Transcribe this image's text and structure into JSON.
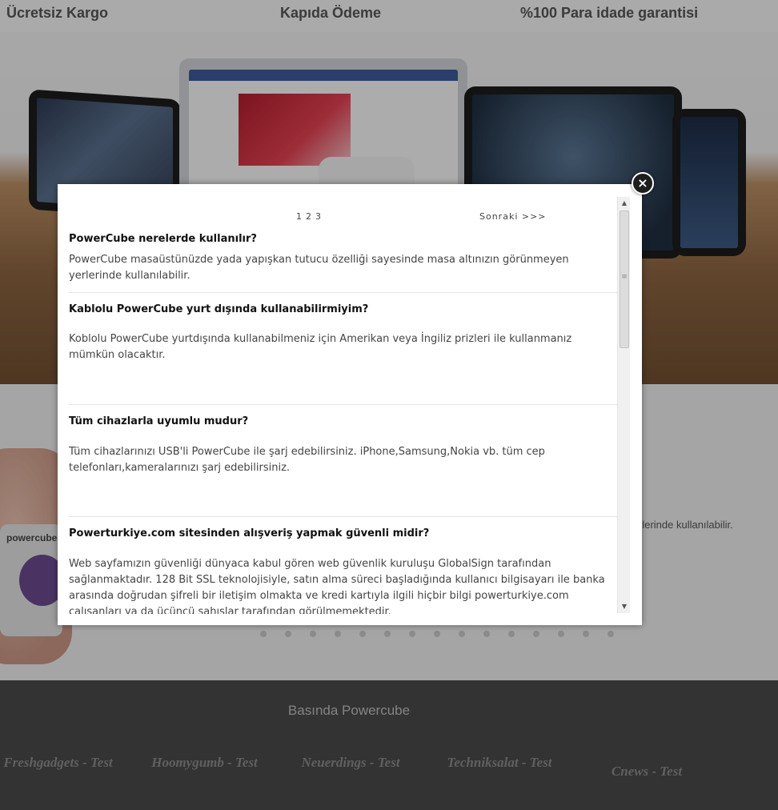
{
  "background": {
    "features": [
      "Ücretsiz Kargo",
      "Kapıda Ödeme",
      "%100 Para idade garantisi"
    ],
    "product_brand": "powercube",
    "side_text": "rlerinde kullanılabilir.",
    "press": {
      "title": "Basında Powercube",
      "logos": [
        "Freshgadgets - Test",
        "Hoomygumb - Test",
        "Neuerdings - Test",
        "Techniksalat - Test",
        "Cnews - Test"
      ]
    },
    "slider_dot_count": 15
  },
  "modal": {
    "close_glyph": "×",
    "pager": {
      "pages": [
        "1",
        "2",
        "3"
      ],
      "next_label": "Sonraki >>>"
    },
    "faqs": [
      {
        "question": "PowerCube nerelerde kullanılır?",
        "answer": "PowerCube masaüstünüzde yada yapışkan tutucu özelliği sayesinde masa altınızın görünmeyen yerlerinde kullanılabilir."
      },
      {
        "question": "Kablolu PowerCube yurt dışında kullanabilirmiyim?",
        "answer": "Koblolu PowerCube yurtdışında kullanabilmeniz için Amerikan veya İngiliz prizleri ile kullanmanız mümkün olacaktır."
      },
      {
        "question": "Tüm cihazlarla uyumlu mudur?",
        "answer": "Tüm cihazlarınızı USB'li PowerCube ile şarj edebilirsiniz. iPhone,Samsung,Nokia vb. tüm cep telefonları,kameralarınızı şarj edebilirsiniz."
      },
      {
        "question": "Powerturkiye.com sitesinden alışveriş yapmak güvenli midir?",
        "answer": "Web sayfamızın güvenliği dünyaca kabul gören web güvenlik kuruluşu GlobalSign tarafından sağlanmaktadır. 128 Bit SSL teknolojisiyle, satın alma süreci başladığında kullanıcı bilgisayarı ile banka arasında doğrudan şifreli bir iletişim olmakta ve kredi kartıyla ilgili hiçbir bilgi powerturkiye.com çalışanları ya da üçüncü şahıslar tarafından görülmemektedir."
      }
    ]
  }
}
